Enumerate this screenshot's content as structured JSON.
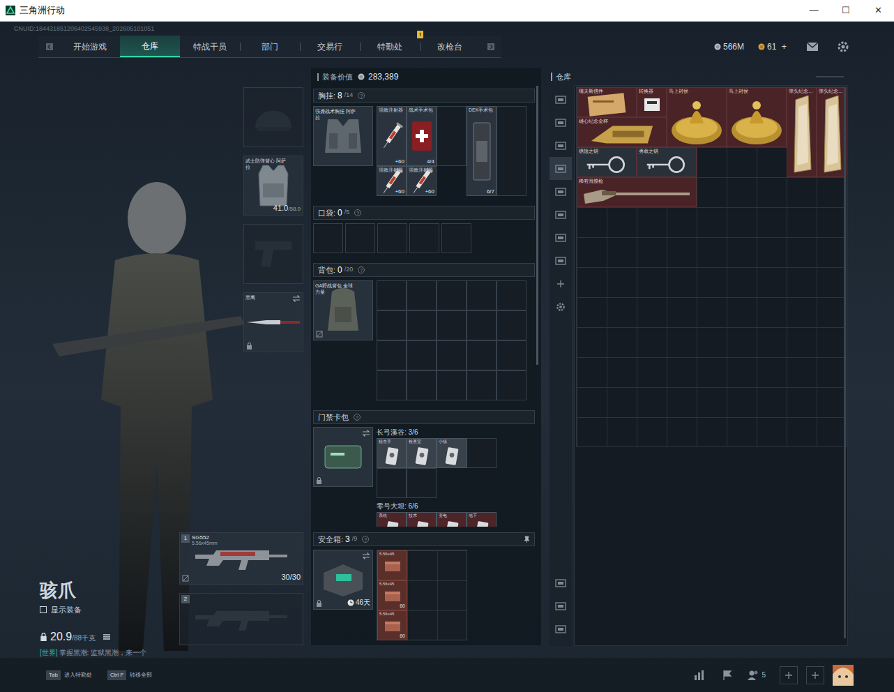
{
  "window": {
    "title": "三角洲行动",
    "controls": [
      "—",
      "☐",
      "✕"
    ]
  },
  "uid": "CNUID:184431851206402545938_202605101051",
  "nav": {
    "tabs": [
      {
        "label": "开始游戏",
        "selected": false
      },
      {
        "label": "仓库",
        "selected": true
      },
      {
        "label": "特战干员",
        "selected": false
      },
      {
        "label": "部门",
        "selected": false
      },
      {
        "label": "交易行",
        "selected": false
      },
      {
        "label": "特勤处",
        "selected": false,
        "badge": "!"
      },
      {
        "label": "改枪台",
        "selected": false
      }
    ]
  },
  "currency": [
    {
      "amount": "566M",
      "kind": "silver"
    },
    {
      "amount": "61",
      "kind": "gold",
      "action": "+"
    }
  ],
  "operator": {
    "name": "骇爪",
    "show_equipment": {
      "label": "显示装备",
      "checked": false
    },
    "weight": "20.9",
    "weight_max": "/88千克",
    "chat": {
      "channel": "[世界]",
      "message": "掌握黑潮: 监狱黑潮，来一个"
    }
  },
  "equipment": [
    {
      "kind": "helmet",
      "empty": true
    },
    {
      "kind": "armor",
      "empty": false,
      "label": "武士防弹背心 阿萨拉",
      "reading": "41.0",
      "reading_max": "/58.0"
    },
    {
      "kind": "pistol",
      "empty": true
    },
    {
      "kind": "melee",
      "empty": false,
      "label": "黑鹰",
      "locked": true
    }
  ],
  "weapons": [
    {
      "number": "1",
      "empty": false,
      "name": "SG552",
      "caliber": "5.56x45mm",
      "ammo": "30/30"
    },
    {
      "number": "2",
      "empty": true
    }
  ],
  "loadout": {
    "value_label": "装备价值",
    "value": "283,389",
    "chest": {
      "title": "胸挂:",
      "count": "8",
      "capacity": "/14",
      "help": "?",
      "rig": "强袭战术胸挂 阿萨拉",
      "items": [
        {
          "kind": "injector",
          "name": "强效注射器",
          "reading": "+60"
        },
        {
          "kind": "medkit",
          "name": "战术手术包",
          "reading": "4/4"
        },
        {
          "kind": "empty"
        },
        {
          "kind": "dek",
          "name": "DEK手术包",
          "reading": "6/7"
        },
        {
          "kind": "empty"
        },
        {
          "kind": "injector",
          "name": "强效注射器",
          "reading": "+60"
        },
        {
          "kind": "injector",
          "name": "强效注射器",
          "reading": "+60"
        }
      ]
    },
    "pockets": {
      "title": "口袋:",
      "count": "0",
      "capacity": "/5",
      "help": "?",
      "slots": 5
    },
    "backpack": {
      "title": "背包:",
      "count": "0",
      "capacity": "/20",
      "help": "?",
      "name": "GA野战背包 全球力量",
      "slots": 20
    },
    "keycards": {
      "title": "门禁卡包",
      "help": "?",
      "locked": true,
      "maps": [
        {
          "name": "长弓溪谷: 3/6",
          "slots": 6,
          "cards": [
            {
              "name": "狙击手",
              "color": "#39424b"
            },
            {
              "name": "检查室",
              "color": "#39424b"
            },
            {
              "name": "小镇",
              "color": "#39424b"
            }
          ]
        },
        {
          "name": "零号大坝: 6/6",
          "cards": [
            {
              "name": "系统",
              "color": "#4d2428"
            },
            {
              "name": "技术",
              "color": "#4d2428"
            },
            {
              "name": "变电",
              "color": "#4d2428"
            },
            {
              "name": "地下",
              "color": "#4d2428"
            }
          ]
        }
      ]
    },
    "safe": {
      "title": "安全箱:",
      "count": "3",
      "capacity": "/9",
      "help": "?",
      "days": "46天",
      "locked": true,
      "slots": 9,
      "items": [
        {
          "name": "5.56x45"
        },
        {
          "name": "5.56x45",
          "count": "60"
        },
        {
          "name": "5.56x45",
          "count": "60"
        }
      ]
    }
  },
  "storage": {
    "title": "仓库",
    "tabs": [
      {
        "selected": false
      },
      {
        "selected": false
      },
      {
        "selected": false
      },
      {
        "selected": true
      },
      {
        "selected": false
      },
      {
        "selected": false
      },
      {
        "selected": false
      },
      {
        "selected": false
      }
    ],
    "items": [
      {
        "name": "瑞夫斯信件",
        "kind": "letter",
        "color": "#4a2327"
      },
      {
        "name": "转换器",
        "kind": "device",
        "color": "#4a2327"
      },
      {
        "name": "马上封侯",
        "kind": "statue",
        "color": "#4a2327"
      },
      {
        "name": "马上封侯",
        "kind": "statue",
        "color": "#4a2327"
      },
      {
        "name": "弹头纪念…",
        "kind": "trophy",
        "color": "#4a2327"
      },
      {
        "name": "弹头纪念…",
        "kind": "trophy",
        "color": "#4a2327"
      },
      {
        "name": "雄心纪念金杯",
        "kind": "plaque",
        "color": "#4a2327"
      },
      {
        "name": "锈蚀之钥",
        "kind": "key",
        "color": "#28313a"
      },
      {
        "name": "勇敢之钥",
        "kind": "key",
        "color": "#28313a"
      },
      {
        "name": "稀有滑膛枪",
        "kind": "musket",
        "color": "#4a2327"
      }
    ]
  },
  "hotkeys": [
    {
      "key": "Tab",
      "label": "进入特勤处"
    },
    {
      "key": "Ctrl F",
      "label": "转移全部"
    }
  ],
  "social": {
    "friends": "5"
  }
}
